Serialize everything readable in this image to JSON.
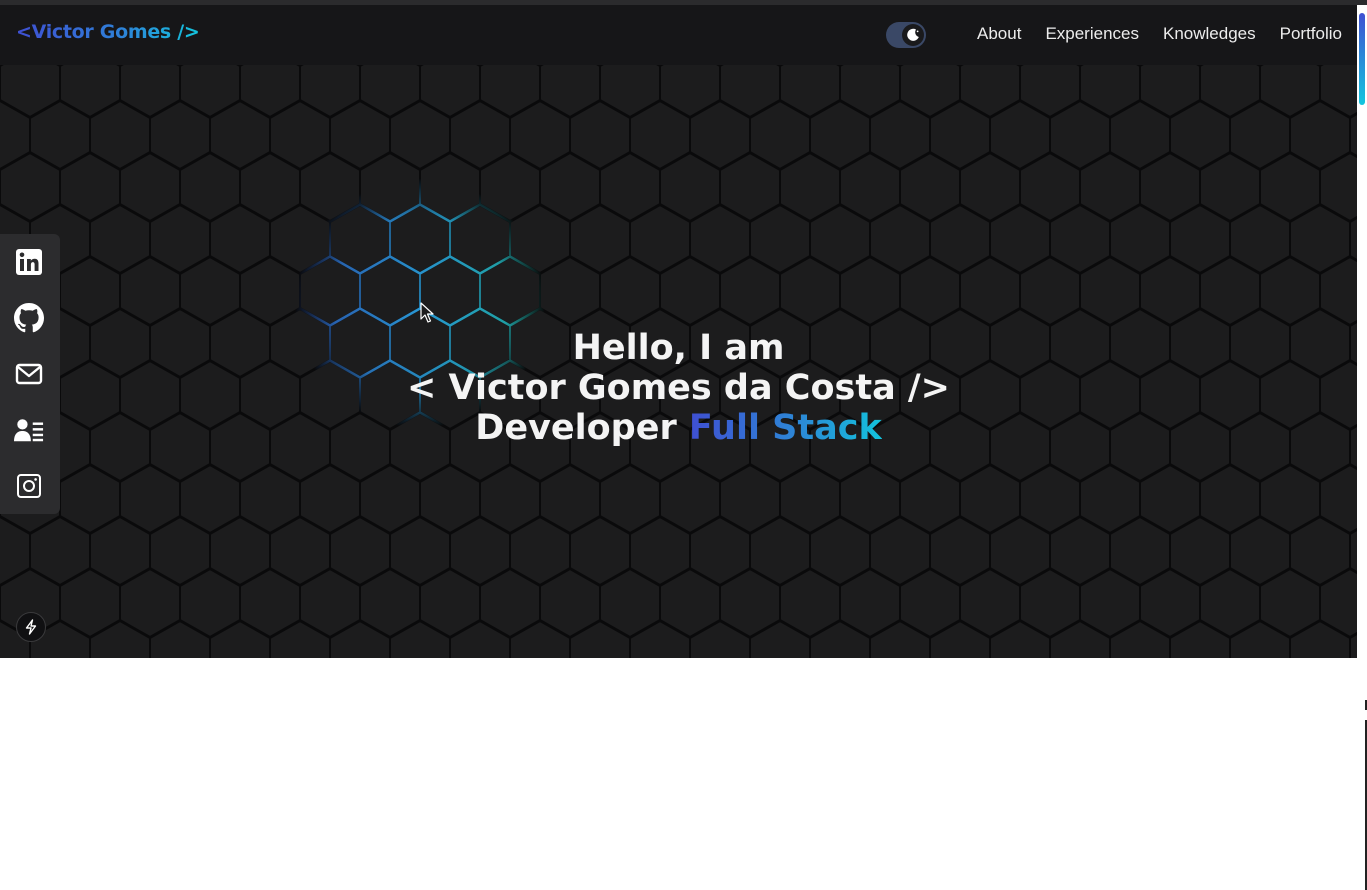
{
  "navbar": {
    "logo": "<Victor Gomes />",
    "theme_toggle_icon": "moon-icon",
    "links": [
      "About",
      "Experiences",
      "Knowledges",
      "Portfolio"
    ]
  },
  "hero": {
    "line1": "Hello, I am",
    "line2": "< Victor Gomes da Costa />",
    "line3_prefix": "Developer ",
    "line3_highlight": "Full Stack"
  },
  "social": [
    {
      "icon": "linkedin-icon"
    },
    {
      "icon": "github-icon"
    },
    {
      "icon": "mail-icon"
    },
    {
      "icon": "contact-card-icon"
    },
    {
      "icon": "instagram-icon"
    }
  ],
  "colors": {
    "accent_start": "#3f4fd2",
    "accent_end": "#13c6de",
    "hero_bg": "#1c1c1d",
    "navbar_bg": "#161618",
    "sidebar_bg": "#2c2c2e"
  }
}
